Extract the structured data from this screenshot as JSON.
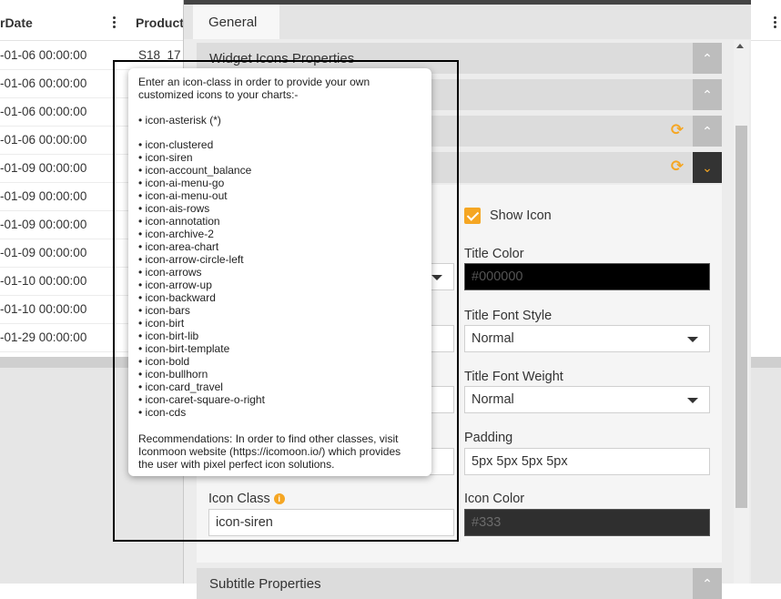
{
  "grid": {
    "col1_header": "rDate",
    "col2_header": "ProductC",
    "rows": [
      {
        "date": "-01-06 00:00:00",
        "product": "S18_17"
      },
      {
        "date": "-01-06 00:00:00",
        "product": ""
      },
      {
        "date": "-01-06 00:00:00",
        "product": ""
      },
      {
        "date": "-01-06 00:00:00",
        "product": ""
      },
      {
        "date": "-01-09 00:00:00",
        "product": ""
      },
      {
        "date": "-01-09 00:00:00",
        "product": ""
      },
      {
        "date": "-01-09 00:00:00",
        "product": ""
      },
      {
        "date": "-01-09 00:00:00",
        "product": ""
      },
      {
        "date": "-01-10 00:00:00",
        "product": ""
      },
      {
        "date": "-01-10 00:00:00",
        "product": ""
      },
      {
        "date": "-01-29 00:00:00",
        "product": ""
      }
    ]
  },
  "panel": {
    "tab_general": "General",
    "sections": {
      "widget_icons": "Widget Icons Properties",
      "subtitle": "Subtitle Properties"
    },
    "show_icon_label": "Show Icon",
    "show_icon_checked": true,
    "title_color_label": "Title Color",
    "title_color_value": "#000000",
    "title_font_style_label": "Title Font Style",
    "title_font_style_value": "Normal",
    "title_font_weight_label": "Title Font Weight",
    "title_font_weight_value": "Normal",
    "padding_label": "Padding",
    "padding_value": "5px 5px 5px 5px",
    "icon_class_label": "Icon Class",
    "icon_class_value": "icon-siren",
    "icon_color_label": "Icon Color",
    "icon_color_value": "#333"
  },
  "tooltip": {
    "intro_1": "Enter an icon-class in order to provide your own",
    "intro_2": "customized icons to your charts:-",
    "asterisk": "• icon-asterisk (*)",
    "icons": [
      "• icon-clustered",
      "• icon-siren",
      "• icon-account_balance",
      "• icon-ai-menu-go",
      "• icon-ai-menu-out",
      "• icon-ais-rows",
      "• icon-annotation",
      "• icon-archive-2",
      "• icon-area-chart",
      "• icon-arrow-circle-left",
      "• icon-arrows",
      "• icon-arrow-up",
      "• icon-backward",
      "• icon-bars",
      "• icon-birt",
      "• icon-birt-lib",
      "• icon-birt-template",
      "• icon-bold",
      "• icon-bullhorn",
      "• icon-card_travel",
      "• icon-caret-square-o-right",
      "• icon-cds"
    ],
    "rec_1": "Recommendations: In order to find other classes, visit",
    "rec_2": "Iconmoon website (https://icomoon.io/) which provides",
    "rec_3": "the user with pixel perfect icon solutions."
  },
  "colors": {
    "accent": "#f5a623",
    "panel_bg": "#ececec",
    "header_dark": "#333333"
  },
  "icons": {
    "collapse": "chevron-up-icon",
    "expand": "chevron-down-icon",
    "refresh": "sync-icon",
    "info": "info-icon",
    "menu": "kebab-menu-icon"
  }
}
